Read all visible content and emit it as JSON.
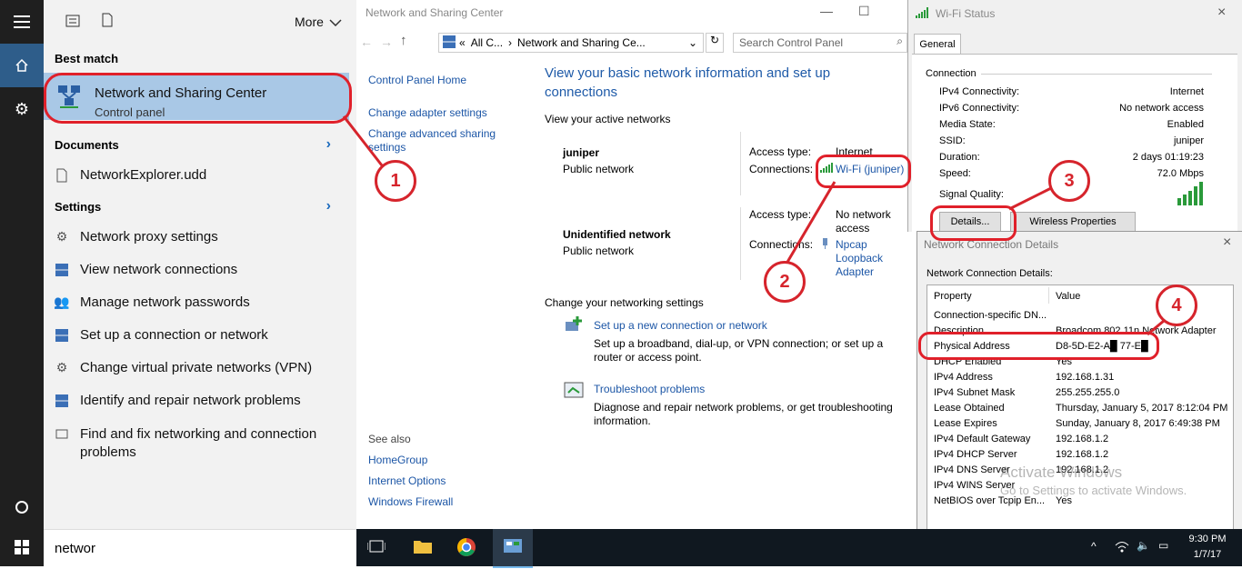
{
  "start_menu": {
    "more_label": "More",
    "best_match_header": "Best match",
    "best_match": {
      "title": "Network and Sharing Center",
      "subtitle": "Control panel"
    },
    "documents_header": "Documents",
    "documents": [
      {
        "label": "NetworkExplorer.udd"
      }
    ],
    "settings_header": "Settings",
    "settings": [
      {
        "label": "Network proxy settings",
        "icon": "gear-icon"
      },
      {
        "label": "View network connections",
        "icon": "network-icon"
      },
      {
        "label": "Manage network passwords",
        "icon": "users-icon"
      },
      {
        "label": "Set up a connection or network",
        "icon": "network-icon"
      },
      {
        "label": "Change virtual private networks (VPN)",
        "icon": "gear-icon"
      },
      {
        "label": "Identify and repair network problems",
        "icon": "network-icon"
      },
      {
        "label": "Find and fix networking and connection problems",
        "icon": "screen-icon"
      }
    ],
    "search_value": "networ"
  },
  "control_panel": {
    "title": "Network and Sharing Center",
    "breadcrumb": [
      "«",
      "All C...",
      "Network and Sharing Ce..."
    ],
    "search_placeholder": "Search Control Panel",
    "sidebar": [
      "Control Panel Home",
      "Change adapter settings",
      "Change advanced sharing settings"
    ],
    "see_also_header": "See also",
    "see_also": [
      "HomeGroup",
      "Internet Options",
      "Windows Firewall"
    ],
    "heading": "View your basic network information and set up connections",
    "active_networks_label": "View your active networks",
    "networks": [
      {
        "name": "juniper",
        "type": "Public network",
        "access_label": "Access type:",
        "access": "Internet",
        "conn_label": "Connections:",
        "conn": "Wi-Fi (juniper)"
      },
      {
        "name": "Unidentified network",
        "type": "Public network",
        "access_label": "Access type:",
        "access": "No network access",
        "conn_label": "Connections:",
        "conn": "Npcap Loopback Adapter"
      }
    ],
    "change_settings_label": "Change your networking settings",
    "tasks": [
      {
        "title": "Set up a new connection or network",
        "desc": "Set up a broadband, dial-up, or VPN connection; or set up a router or access point."
      },
      {
        "title": "Troubleshoot problems",
        "desc": "Diagnose and repair network problems, or get troubleshooting information."
      }
    ]
  },
  "wifi_status": {
    "title": "Wi-Fi Status",
    "tab": "General",
    "section": "Connection",
    "rows": [
      {
        "k": "IPv4 Connectivity:",
        "v": "Internet"
      },
      {
        "k": "IPv6 Connectivity:",
        "v": "No network access"
      },
      {
        "k": "Media State:",
        "v": "Enabled"
      },
      {
        "k": "SSID:",
        "v": "juniper"
      },
      {
        "k": "Duration:",
        "v": "2 days 01:19:23"
      },
      {
        "k": "Speed:",
        "v": "72.0 Mbps"
      }
    ],
    "signal_label": "Signal Quality:",
    "details_button": "Details...",
    "wireless_button": "Wireless Properties"
  },
  "details": {
    "title": "Network Connection Details",
    "label": "Network Connection Details:",
    "col_property": "Property",
    "col_value": "Value",
    "rows": [
      {
        "k": "Connection-specific DN...",
        "v": ""
      },
      {
        "k": "Description",
        "v": "Broadcom 802.11n Network Adapter"
      },
      {
        "k": "Physical Address",
        "v": "D8-5D-E2-A█ 77-E█"
      },
      {
        "k": "DHCP Enabled",
        "v": "Yes"
      },
      {
        "k": "IPv4 Address",
        "v": "192.168.1.31"
      },
      {
        "k": "IPv4 Subnet Mask",
        "v": "255.255.255.0"
      },
      {
        "k": "Lease Obtained",
        "v": "Thursday, January 5, 2017 8:12:04 PM"
      },
      {
        "k": "Lease Expires",
        "v": "Sunday, January 8, 2017 6:49:38 PM"
      },
      {
        "k": "IPv4 Default Gateway",
        "v": "192.168.1.2"
      },
      {
        "k": "IPv4 DHCP Server",
        "v": "192.168.1.2"
      },
      {
        "k": "IPv4 DNS Server",
        "v": "192.168.1.2"
      },
      {
        "k": "IPv4 WINS Server",
        "v": ""
      },
      {
        "k": "NetBIOS over Tcpip En...",
        "v": "Yes"
      }
    ],
    "watermark1": "Activate Windows",
    "watermark2": "Go to Settings to activate Windows."
  },
  "taskbar": {
    "time": "9:30 PM",
    "date": "1/7/17"
  },
  "callouts": [
    "1",
    "2",
    "3",
    "4"
  ],
  "colors": {
    "accent": "#e0202a",
    "link": "#1c56a6",
    "selection": "#a9c8e6"
  }
}
